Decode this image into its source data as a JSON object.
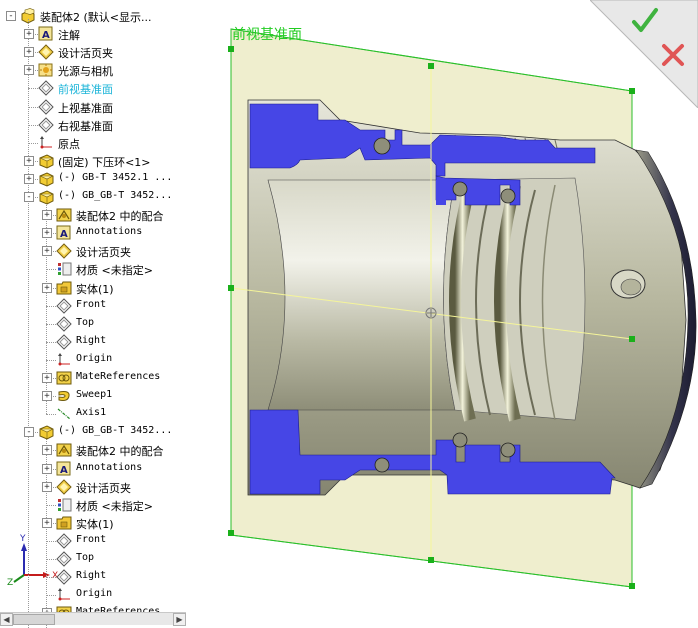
{
  "tree": {
    "root": "装配体2  (默认<显示...",
    "items": [
      {
        "label": "注解",
        "icon": "annotation-icon"
      },
      {
        "label": "设计活页夹",
        "icon": "binder-icon"
      },
      {
        "label": "光源与相机",
        "icon": "light-camera-icon"
      },
      {
        "label": "前视基准面",
        "icon": "plane-icon",
        "selected": true
      },
      {
        "label": "上视基准面",
        "icon": "plane-icon"
      },
      {
        "label": "右视基准面",
        "icon": "plane-icon"
      },
      {
        "label": "原点",
        "icon": "origin-icon"
      },
      {
        "label": "(固定) 下压环<1>",
        "icon": "part-icon"
      },
      {
        "label": "(-) GB-T 3452.1 ...",
        "icon": "part-icon"
      },
      {
        "label": "(-) GB_GB-T 3452...",
        "icon": "part-icon"
      },
      {
        "label": "装配体2 中的配合",
        "icon": "mate-icon"
      },
      {
        "label": "Annotations",
        "icon": "annotation-icon"
      },
      {
        "label": "设计活页夹",
        "icon": "binder-icon"
      },
      {
        "label": "材质 <未指定>",
        "icon": "material-icon"
      },
      {
        "label": "实体(1)",
        "icon": "solid-folder-icon"
      },
      {
        "label": "Front",
        "icon": "plane-icon"
      },
      {
        "label": "Top",
        "icon": "plane-icon"
      },
      {
        "label": "Right",
        "icon": "plane-icon"
      },
      {
        "label": "Origin",
        "icon": "origin-icon"
      },
      {
        "label": "MateReferences",
        "icon": "mate-ref-icon"
      },
      {
        "label": "Sweep1",
        "icon": "sweep-icon"
      },
      {
        "label": "Axis1",
        "icon": "axis-icon"
      },
      {
        "label": "(-) GB_GB-T 3452...",
        "icon": "part-icon"
      },
      {
        "label": "装配体2 中的配合",
        "icon": "mate-icon"
      },
      {
        "label": "Annotations",
        "icon": "annotation-icon"
      },
      {
        "label": "设计活页夹",
        "icon": "binder-icon"
      },
      {
        "label": "材质 <未指定>",
        "icon": "material-icon"
      },
      {
        "label": "实体(1)",
        "icon": "solid-folder-icon"
      },
      {
        "label": "Front",
        "icon": "plane-icon"
      },
      {
        "label": "Top",
        "icon": "plane-icon"
      },
      {
        "label": "Right",
        "icon": "plane-icon"
      },
      {
        "label": "Origin",
        "icon": "origin-icon"
      },
      {
        "label": "MateReferences",
        "icon": "mate-ref-icon"
      }
    ]
  },
  "viewport": {
    "plane_label": "前视基准面",
    "triad": {
      "x": "X",
      "y": "Y",
      "z": "Z"
    }
  },
  "confirm_corner": {
    "ok_icon": "check-icon",
    "cancel_icon": "close-icon"
  },
  "colors": {
    "section_face": "#4646e6",
    "body_metal": "#c4c4b2",
    "plane_fill": "#ecebc6",
    "plane_border": "#2bbf2b",
    "plane_label": "#22cc22",
    "selected_text": "#1ab4d8",
    "ok_green": "#3fb33f",
    "cancel_red": "#e05555"
  }
}
